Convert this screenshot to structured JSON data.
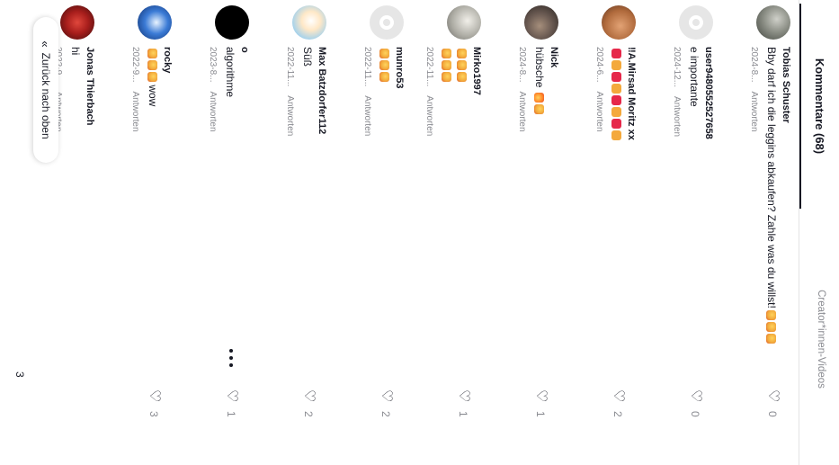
{
  "tabs": {
    "comments": "Kommentare (68)",
    "creator_videos": "Creator*innen-Videos"
  },
  "reply_label": "Antworten",
  "comments": [
    {
      "username": "Tobias Schuster",
      "text": "Bby darf ich die leggins abkaufen? Zahle was du willst!",
      "date": "2024-8...",
      "likes": "0"
    },
    {
      "username": "user9480552527658",
      "text": "e importante",
      "date": "2024-12...",
      "likes": "0"
    },
    {
      "username": "‼A.Mirsad Moritz xx",
      "text": "",
      "date": "2024-6...",
      "likes": "2"
    },
    {
      "username": "Nick",
      "text": "hübsche",
      "date": "2024-8...",
      "likes": "1"
    },
    {
      "username": "Mirko1997",
      "text": "",
      "date": "2022-11...",
      "likes": "1"
    },
    {
      "username": "munro53",
      "text": "",
      "date": "2022-11...",
      "likes": "2"
    },
    {
      "username": "Max Batzdorfer112",
      "text": "Süß",
      "date": "2022-11...",
      "likes": "2"
    },
    {
      "username": "o",
      "text": "algorithme",
      "date": "2023-8...",
      "likes": "1"
    },
    {
      "username": "rocky",
      "text": "wow",
      "date": "2022-9...",
      "likes": "3"
    },
    {
      "username": "Jonas Thierbach",
      "text": "hi",
      "date": "2022-9...",
      "likes": ""
    }
  ],
  "back_to_top": {
    "label": "Zurück nach oben",
    "icon": "double-chevron-up-icon"
  },
  "bottom_likes": "3",
  "icons": {
    "like": "heart-outline-icon",
    "more": "more-dots-icon"
  },
  "colors": {
    "text": "#161823",
    "muted": "#8a8b91",
    "divider": "#e3e3e4"
  }
}
